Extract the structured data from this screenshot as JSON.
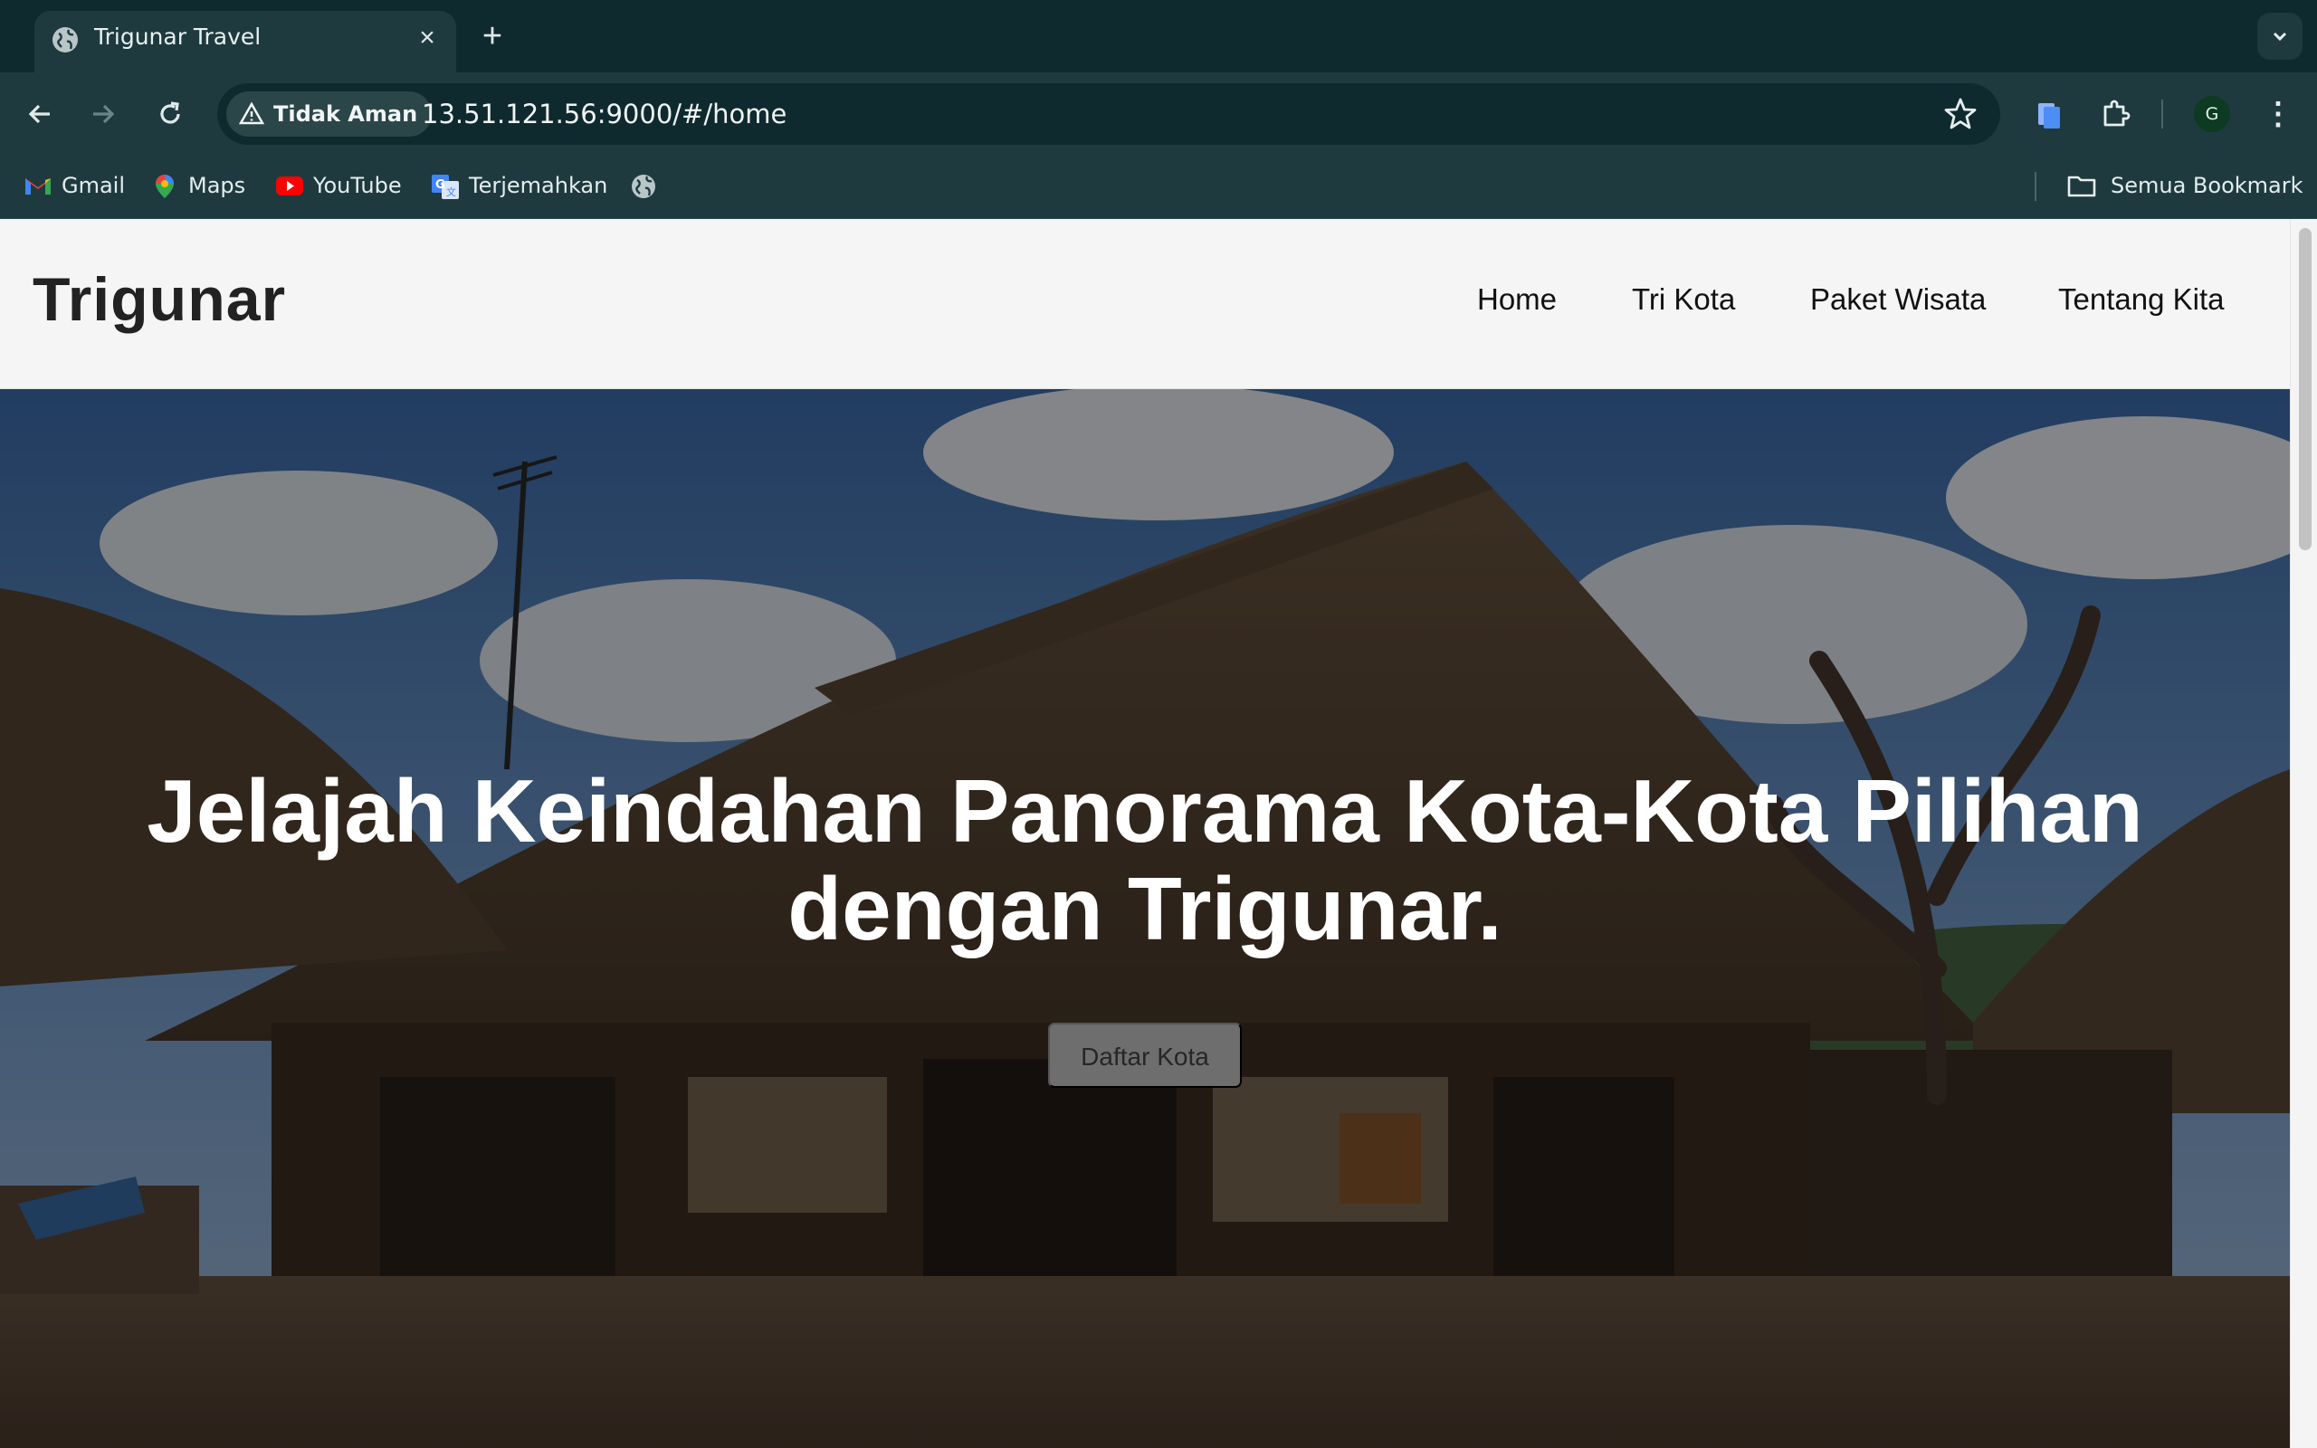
{
  "browser": {
    "tab_title": "Trigunar Travel",
    "security_label": "Tidak Aman",
    "url": "13.51.121.56:9000/#/home",
    "profile_initial": "G",
    "bookmarks": [
      {
        "label": "Gmail",
        "icon": "gmail-icon"
      },
      {
        "label": "Maps",
        "icon": "maps-icon"
      },
      {
        "label": "YouTube",
        "icon": "youtube-icon"
      },
      {
        "label": "Terjemahkan",
        "icon": "translate-icon"
      }
    ],
    "all_bookmarks_label": "Semua Bookmark",
    "colors": {
      "chrome_bg": "#1e3a3f",
      "tabstrip_bg": "#0f2a2e"
    }
  },
  "site": {
    "brand": "Trigunar",
    "nav": [
      "Home",
      "Tri Kota",
      "Paket Wisata",
      "Tentang Kita"
    ],
    "hero": {
      "title": "Jelajah Keindahan Panorama Kota-Kota Pilihan dengan Trigunar.",
      "button": "Daftar Kota"
    }
  }
}
